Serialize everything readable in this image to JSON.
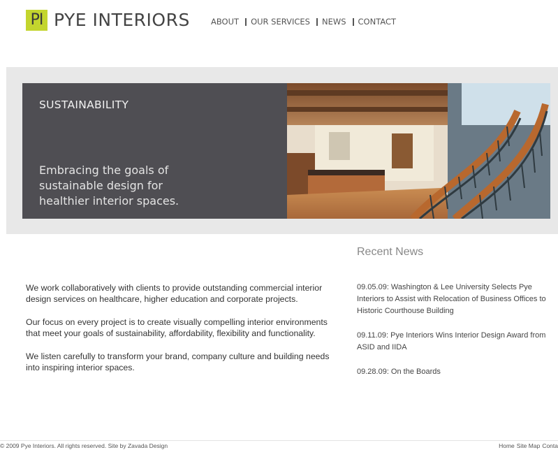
{
  "brand": {
    "mark": "PI",
    "name": "PYE INTERIORS"
  },
  "nav": {
    "items": [
      {
        "label": "ABOUT"
      },
      {
        "label": "OUR SERVICES"
      },
      {
        "label": "NEWS"
      },
      {
        "label": "CONTACT"
      }
    ]
  },
  "hero": {
    "title": "SUSTAINABILITY",
    "tagline": [
      "Embracing the goals of",
      "sustainable design for",
      "healthier interior spaces."
    ]
  },
  "intro": {
    "paragraphs": [
      "We work collaboratively with clients to provide outstanding commercial interior design services on healthcare, higher education and corporate projects.",
      "Our focus on every project is to create visually compelling interior environments that meet your goals of sustainability, affordability, flexibility and functionality.",
      "We listen carefully to transform your brand, company culture and building needs into inspiring interior spaces."
    ]
  },
  "news": {
    "heading": "Recent News",
    "items": [
      "09.05.09: Washington & Lee University Selects Pye Interiors to Assist with Relocation of Business Offices to Historic Courthouse Building",
      "09.11.09: Pye Interiors Wins Interior Design Award from ASID and IIDA",
      "09.28.09: On the Boards"
    ]
  },
  "footer": {
    "copyright": "© 2009 Pye Interiors. All rights reserved. Site by Zavada Design",
    "links": [
      "Home",
      "Site Map",
      "Conta"
    ]
  },
  "colors": {
    "accent": "#c3d52e",
    "hero_panel": "#4f4e53",
    "hero_band": "#e8e8e8"
  }
}
